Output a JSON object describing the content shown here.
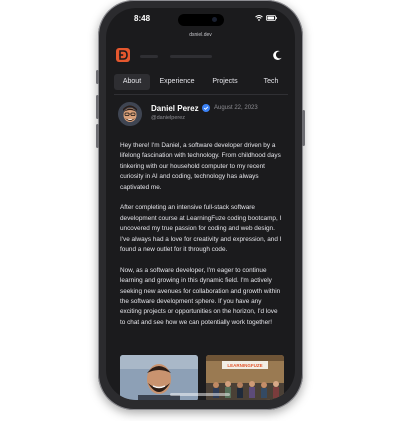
{
  "status_bar": {
    "time": "8:48",
    "icons": [
      "wifi-icon",
      "battery-icon"
    ]
  },
  "browser": {
    "url": "dsniel.dev"
  },
  "brand": {
    "accent": "#e4572e",
    "logo_icon": "logo-d-icon"
  },
  "header": {
    "theme_icon": "moon-icon"
  },
  "tabs": [
    {
      "label": "About",
      "active": true
    },
    {
      "label": "Experience",
      "active": false
    },
    {
      "label": "Projects",
      "active": false
    },
    {
      "label": "Tech",
      "active": false
    }
  ],
  "profile": {
    "name": "Daniel Perez",
    "verified_icon": "verified-badge-icon",
    "verified_color": "#3b82f6",
    "date": "August 22, 2023",
    "handle": "@danielperez"
  },
  "bio": {
    "paragraphs": [
      "Hey there! I'm Daniel, a software developer driven by a lifelong fascination with technology. From childhood days tinkering with our household computer to my recent curiosity in AI and coding, technology has always captivated me.",
      "After completing an intensive full-stack software development course at LearningFuze coding bootcamp, I uncovered my true passion for coding and web design. I've always had a love for creativity and expression, and I found a new outlet for it through code.",
      "Now, as a software developer, I'm eager to continue learning and growing in this dynamic field. I'm actively seeking new avenues for collaboration and growth within the software development sphere. If you have any exciting projects or opportunities on the horizon, I'd love to chat and see how we can potentially work together!"
    ]
  },
  "photos": {
    "sign_text": "LEARNINGFUZE"
  }
}
